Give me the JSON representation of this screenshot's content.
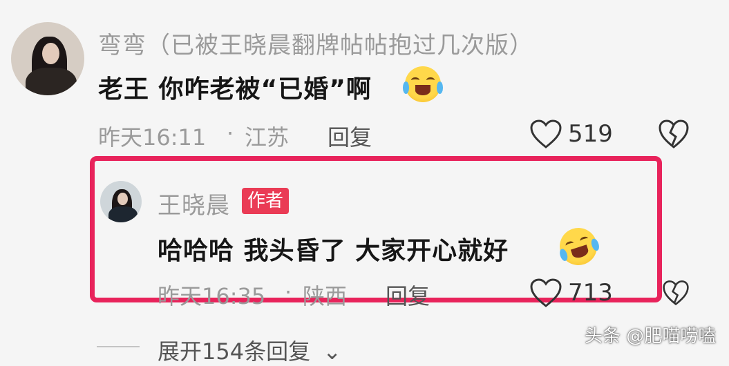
{
  "comments": [
    {
      "username": "弯弯（已被王晓晨翻牌帖帖抱过几次版）",
      "text": "老王 你咋老被“已婚”啊",
      "emoji": "crying-laughing-emoji",
      "time": "昨天16:11",
      "separator": "·",
      "location": "江苏",
      "reply_label": "回复",
      "likes": "519"
    }
  ],
  "reply": {
    "username": "王晓晨",
    "badge": "作者",
    "text": "哈哈哈 我头昏了 大家开心就好",
    "emoji": "rolling-laughing-emoji",
    "time": "昨天16:35",
    "separator": "·",
    "location": "陕西",
    "reply_label": "回复",
    "likes": "713"
  },
  "expand": {
    "label": "展开154条回复",
    "icon": "chevron-down-icon"
  },
  "watermark": "头条 @肥喵唠嗑",
  "colors": {
    "highlight": "#e8235b",
    "badge": "#ea3b55"
  }
}
